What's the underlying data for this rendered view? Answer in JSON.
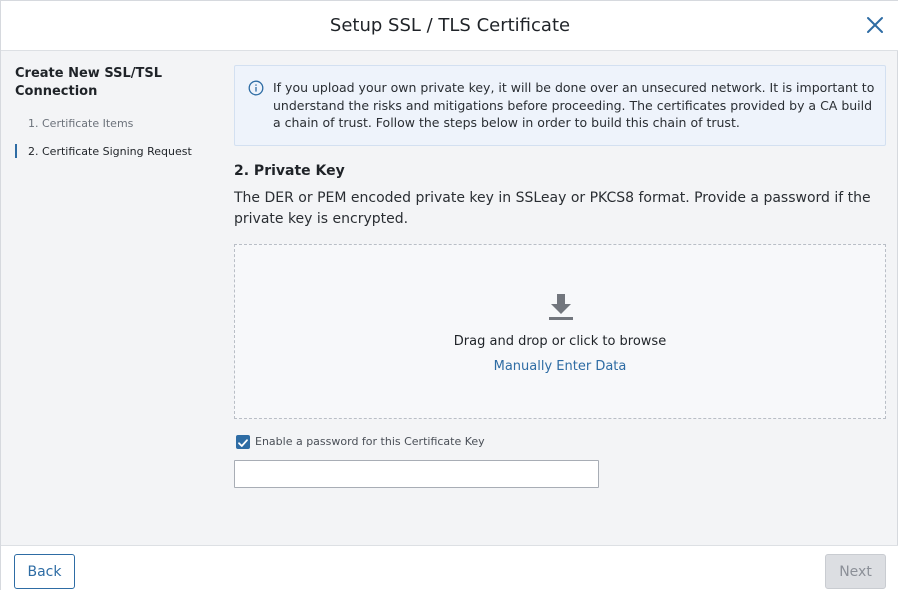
{
  "header": {
    "title": "Setup SSL / TLS Certificate",
    "close_icon": "close-icon"
  },
  "sidebar": {
    "title": "Create New SSL/TSL Connection",
    "steps": [
      {
        "label": "1. Certificate Items",
        "active": false
      },
      {
        "label": "2. Certificate Signing Request",
        "active": true
      }
    ]
  },
  "info": {
    "icon": "info-icon",
    "text": "If you upload your own private key, it will be done over an unsecured network. It is important to understand the risks and mitigations before proceeding. The certificates provided by a CA build a chain of trust. Follow the steps below in order to build this chain of trust."
  },
  "section": {
    "title": "2. Private Key",
    "description": "The DER or PEM encoded private key in SSLeay or PKCS8 format. Provide a password if the private key is encrypted."
  },
  "dropzone": {
    "icon": "download-icon",
    "text": "Drag and drop or click to browse",
    "link": "Manually Enter Data"
  },
  "password": {
    "checkbox_label": "Enable a password for this Certificate Key",
    "checked": true,
    "value": "",
    "placeholder": ""
  },
  "footer": {
    "back_label": "Back",
    "next_label": "Next",
    "next_disabled": true
  },
  "colors": {
    "accent": "#2e6ca4",
    "info_bg": "#eef3fb",
    "disabled_bg": "#dcdee2"
  }
}
